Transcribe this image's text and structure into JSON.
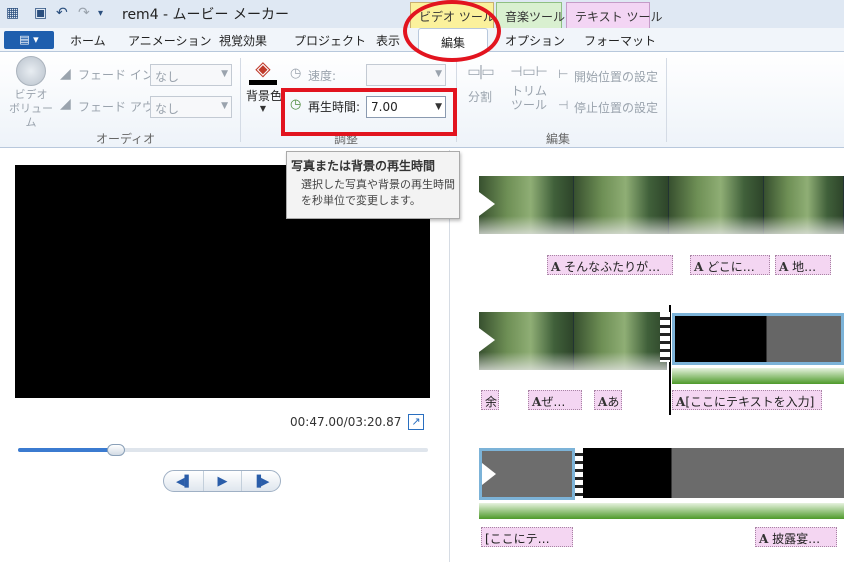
{
  "titlebar": {
    "title": "rem4 - ムービー メーカー",
    "context_tabs": [
      {
        "label": "ビデオ ツール",
        "color": "#fbf19c"
      },
      {
        "label": "音楽ツール",
        "color": "#d9f0d0"
      },
      {
        "label": "テキスト ツール",
        "color": "#f3d5f4"
      }
    ]
  },
  "ribbon_tabs": {
    "file_menu": "▤ ▾",
    "items": [
      "ホーム",
      "アニメーション",
      "視覚効果",
      "プロジェクト",
      "表示",
      "編集",
      "オプション",
      "フォーマット"
    ],
    "active": "編集"
  },
  "ribbon": {
    "audio": {
      "video_volume": "ビデオ\nボリューム",
      "fade_in_label": "フェード イン:",
      "fade_in_value": "なし",
      "fade_out_label": "フェード アウト:",
      "fade_out_value": "なし",
      "group_label": "オーディオ"
    },
    "adjust": {
      "bg_color": "背景色",
      "speed_label": "速度:",
      "duration_label": "再生時間:",
      "duration_value": "7.00",
      "group_label": "調整"
    },
    "edit": {
      "split": "分割",
      "trim": "トリム\nツール",
      "set_start": "開始位置の設定",
      "set_end": "停止位置の設定",
      "group_label": "編集"
    }
  },
  "tooltip": {
    "title": "写真または背景の再生時間",
    "body": "選択した写真や背景の再生時間を秒単位で変更します。"
  },
  "preview": {
    "time": "00:47.00/03:20.87",
    "seek_position": 0.24
  },
  "timeline": {
    "captions_row1": [
      "そんなふたりが…",
      "どこに…",
      "地…"
    ],
    "captions_row2": [
      "余",
      "ぜ…",
      "あ",
      "[ここにテキストを入力]"
    ],
    "captions_row3": [
      "[ここにテ…",
      "披露宴…"
    ]
  },
  "colors": {
    "highlight_red": "#e2141f",
    "audio_green": "#4e9a2a",
    "caption_pink": "#f4d6f2"
  }
}
